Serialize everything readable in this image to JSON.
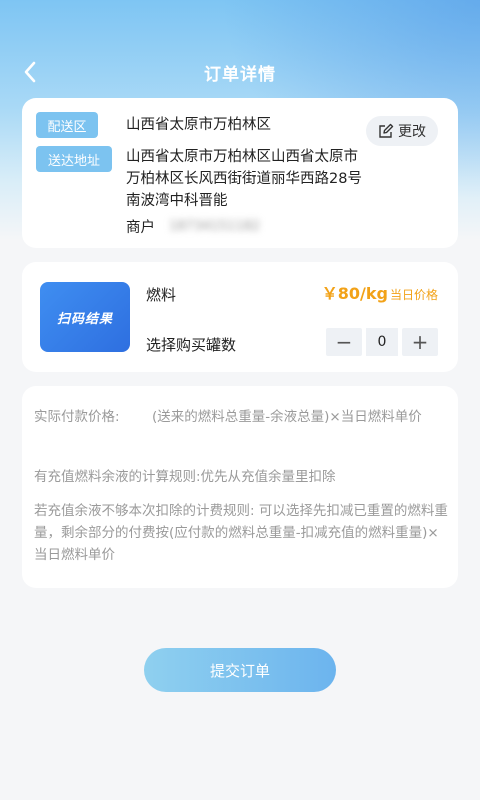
{
  "header": {
    "title": "订单详情"
  },
  "address": {
    "delivery_area_tag": "配送区",
    "delivery_area": "山西省太原市万柏林区",
    "address_tag": "送达地址",
    "address": "山西省太原市万柏林区山西省太原市万柏林区长风西街街道丽华西路28号南波湾中科晋能",
    "merchant_label": "商户",
    "merchant_value": "18734151182",
    "edit_label": "更改"
  },
  "product": {
    "scan_text": "扫码结果",
    "name": "燃料",
    "price": "￥80/kg",
    "price_note": "当日价格",
    "qty_label": "选择购买罐数",
    "qty_value": "0",
    "minus": "−",
    "plus": "+"
  },
  "rules": {
    "actual_label": "实际付款价格:",
    "actual_formula": "(送来的燃料总重量-余液总量)×当日燃料单价",
    "rule2": "有充值燃料余液的计算规则:优先从充值余量里扣除",
    "rule3": "若充值余液不够本次扣除的计费规则: 可以选择先扣减已重置的燃料重量，剩余部分的付费按(应付款的燃料总重量-扣减充值的燃料重量)×当日燃料单价"
  },
  "submit_label": "提交订单",
  "colors": {
    "accent": "#7cc3f0",
    "price": "#f2a218",
    "scan_bg": "#2e6fe0"
  }
}
